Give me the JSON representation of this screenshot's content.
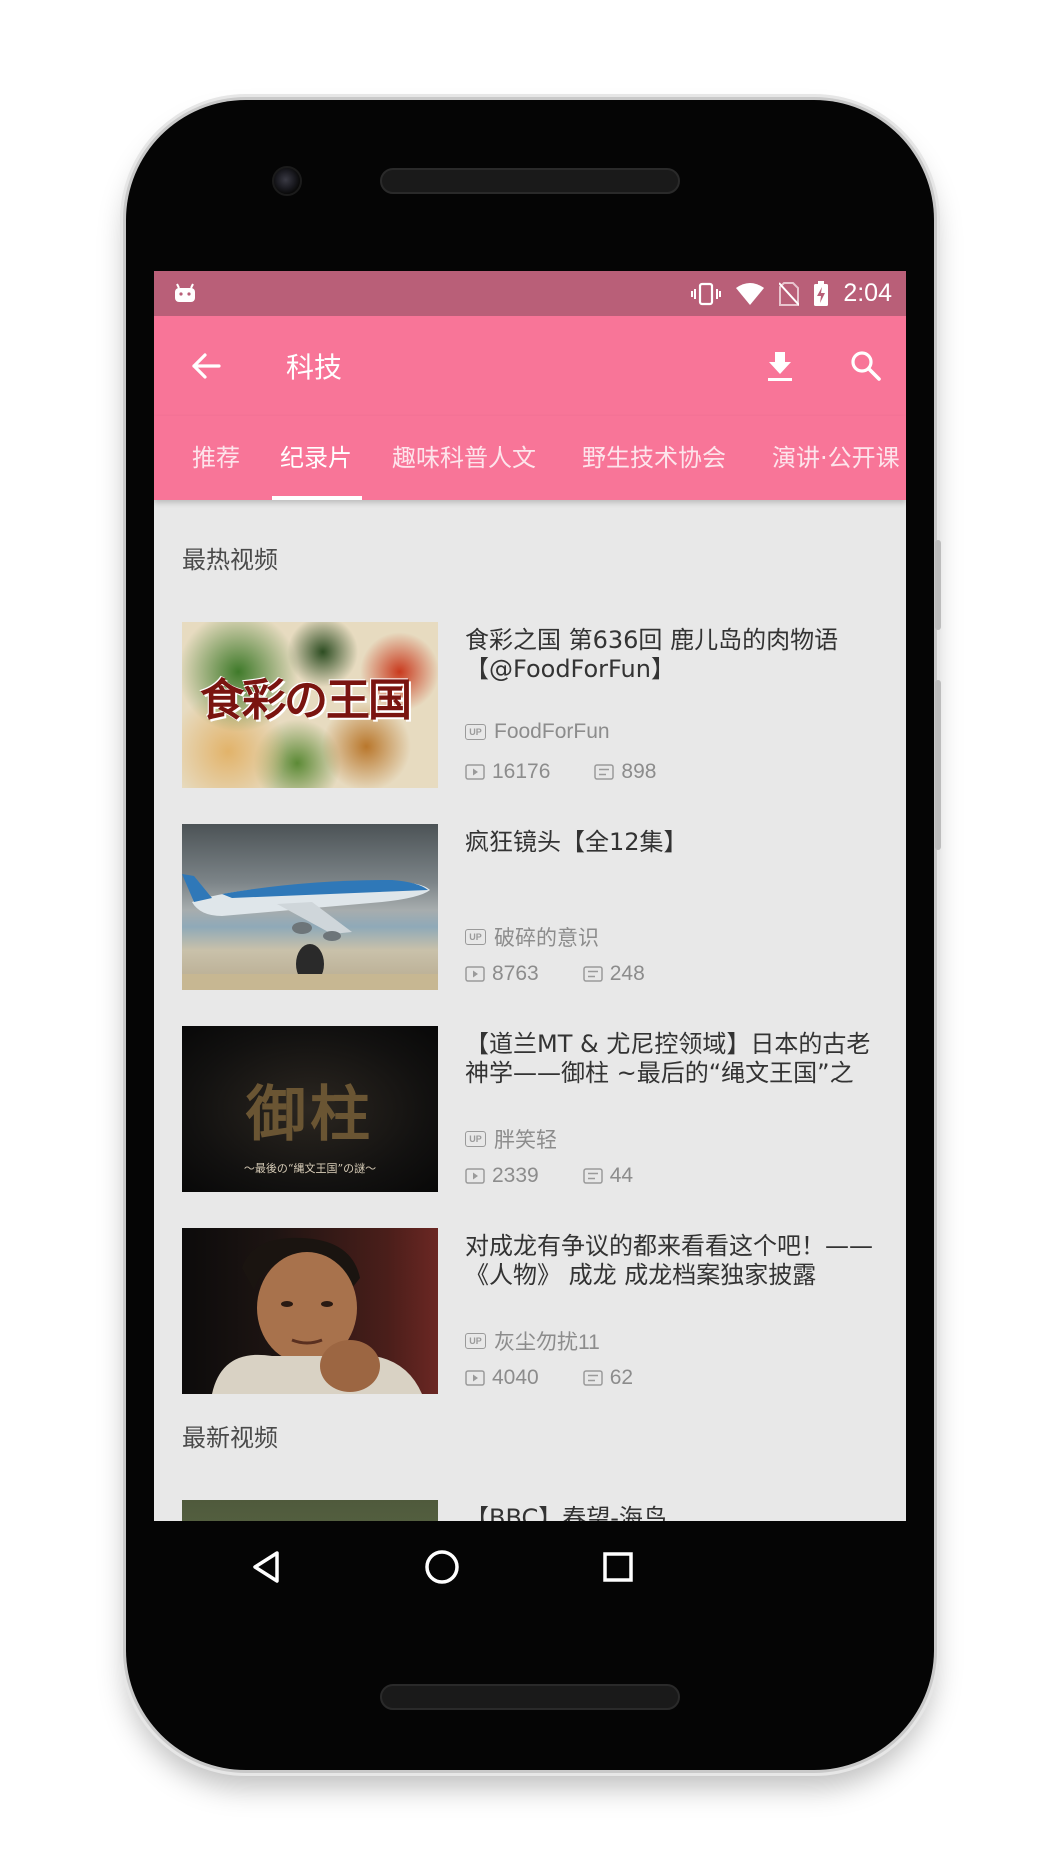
{
  "status_bar": {
    "time": "2:04",
    "icons": [
      "android-icon",
      "vibrate-icon",
      "wifi-icon",
      "no-sim-icon",
      "battery-charging-icon"
    ]
  },
  "app_bar": {
    "title": "科技",
    "icons": [
      "back-arrow-icon",
      "download-icon",
      "search-icon"
    ]
  },
  "tabs": [
    {
      "label": "推荐",
      "active": false
    },
    {
      "label": "纪录片",
      "active": true
    },
    {
      "label": "趣味科普人文",
      "active": false
    },
    {
      "label": "野生技术协会",
      "active": false
    },
    {
      "label": "演讲·公开课",
      "active": false
    }
  ],
  "sections": {
    "hot": {
      "title": "最热视频"
    },
    "new": {
      "title": "最新视频"
    }
  },
  "videos": [
    {
      "title": "食彩之国 第636回 鹿儿岛的肉物语【@FoodForFun】",
      "uploader": "FoodForFun",
      "views": "16176",
      "danmaku": "898",
      "thumb_text": "食彩の王国"
    },
    {
      "title": "疯狂镜头【全12集】",
      "uploader": "破碎的意识",
      "views": "8763",
      "danmaku": "248"
    },
    {
      "title": "【道兰MT & 尤尼控领域】日本的古老神学——御柱 ~最后的“绳文王国”之谜~",
      "uploader": "胖笑轻",
      "views": "2339",
      "danmaku": "44",
      "thumb_text": "御柱",
      "thumb_subtitle": "〜最後の“縄文王国”の謎〜"
    },
    {
      "title": " 对成龙有争议的都来看看这个吧！——《人物》 成龙 成龙档案独家披露",
      "uploader": "灰尘勿扰11",
      "views": "4040",
      "danmaku": "62"
    },
    {
      "title": "【BBC】春望-海鸟"
    }
  ],
  "nav_bar": {
    "icons": [
      "nav-back-icon",
      "nav-home-icon",
      "nav-recents-icon"
    ]
  },
  "colors": {
    "status_bar": "#b95f78",
    "app_bar": "#f87598",
    "background": "#e8e8e8"
  }
}
